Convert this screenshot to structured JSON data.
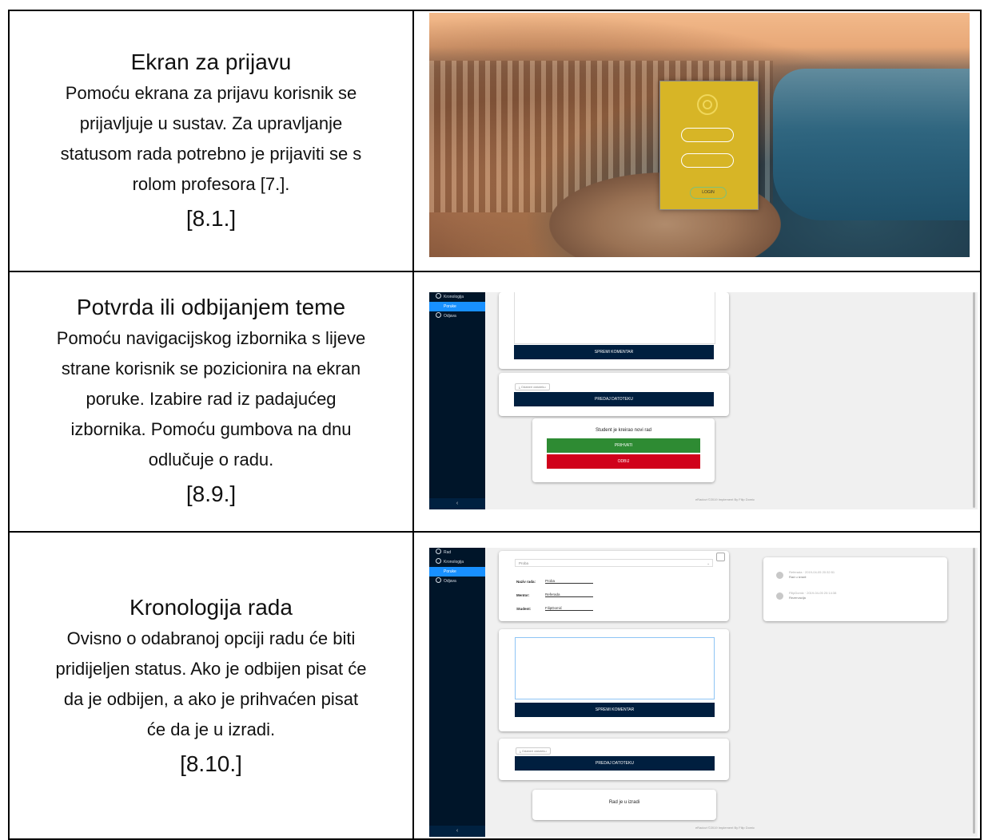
{
  "rows": [
    {
      "title": "Ekran za prijavu",
      "body": [
        "Pomoću ekrana za prijavu korisnik se",
        "prijavljuje u sustav. Za upravljanje",
        "statusom rada potrebno je prijaviti se s",
        "rolom profesora [7.]."
      ],
      "ref": "[8.1.]"
    },
    {
      "title": "Potvrda ili odbijanjem teme",
      "body": [
        "Pomoću navigacijskog izbornika s lijeve",
        "strane korisnik se pozicionira na ekran",
        "poruke. Izabire rad iz padajućeg",
        "izbornika. Pomoću gumbova na dnu",
        "odlučuje o radu."
      ],
      "ref": "[8.9.]"
    },
    {
      "title": "Kronologija rada",
      "body": [
        "Ovisno o odabranoj opciji radu će biti",
        "pridijeljen status. Ako je odbijen pisat će",
        "da je odbijen, a ako je prihvaćen pisat",
        "će da je u izradi."
      ],
      "ref": "[8.10.]"
    }
  ],
  "login_shot": {
    "button": "LOGIN"
  },
  "shot2": {
    "sidebar": [
      "Kronologija",
      "Poruke",
      "Odjava"
    ],
    "save_comment": "SPREMI KOMENTAR",
    "choose_file": "Odaberi datoteku",
    "submit_file": "PREDAJ DATOTEKU",
    "status_title": "Student je kreirao novi rad",
    "accept": "PRIHVATI",
    "reject": "ODBIJ",
    "footer": "eRadovi ©2019 Implement By Filip Domic",
    "collapse": "‹"
  },
  "shot3": {
    "sidebar": [
      "Rad",
      "Kronologija",
      "Poruke",
      "Odjava"
    ],
    "select_value": "Proba",
    "fields": [
      {
        "label": "Naziv rada:",
        "value": "Proba"
      },
      {
        "label": "Mentor:",
        "value": "Referada"
      },
      {
        "label": "Student:",
        "value": "FilipDomić"
      }
    ],
    "timeline": [
      {
        "who": "Referada · 2019-04-05 20:32:51",
        "text": "Rad u izradi"
      },
      {
        "who": "FilipDomić · 2019-04-05 20:14:38",
        "text": "Rezervacija"
      }
    ],
    "save_comment": "SPREMI KOMENTAR",
    "choose_file": "Odaberi datoteku",
    "submit_file": "PREDAJ DATOTEKU",
    "status": "Rad je u izradi",
    "footer": "eRadovi ©2019 Implement By Filip Domic",
    "collapse": "‹"
  }
}
